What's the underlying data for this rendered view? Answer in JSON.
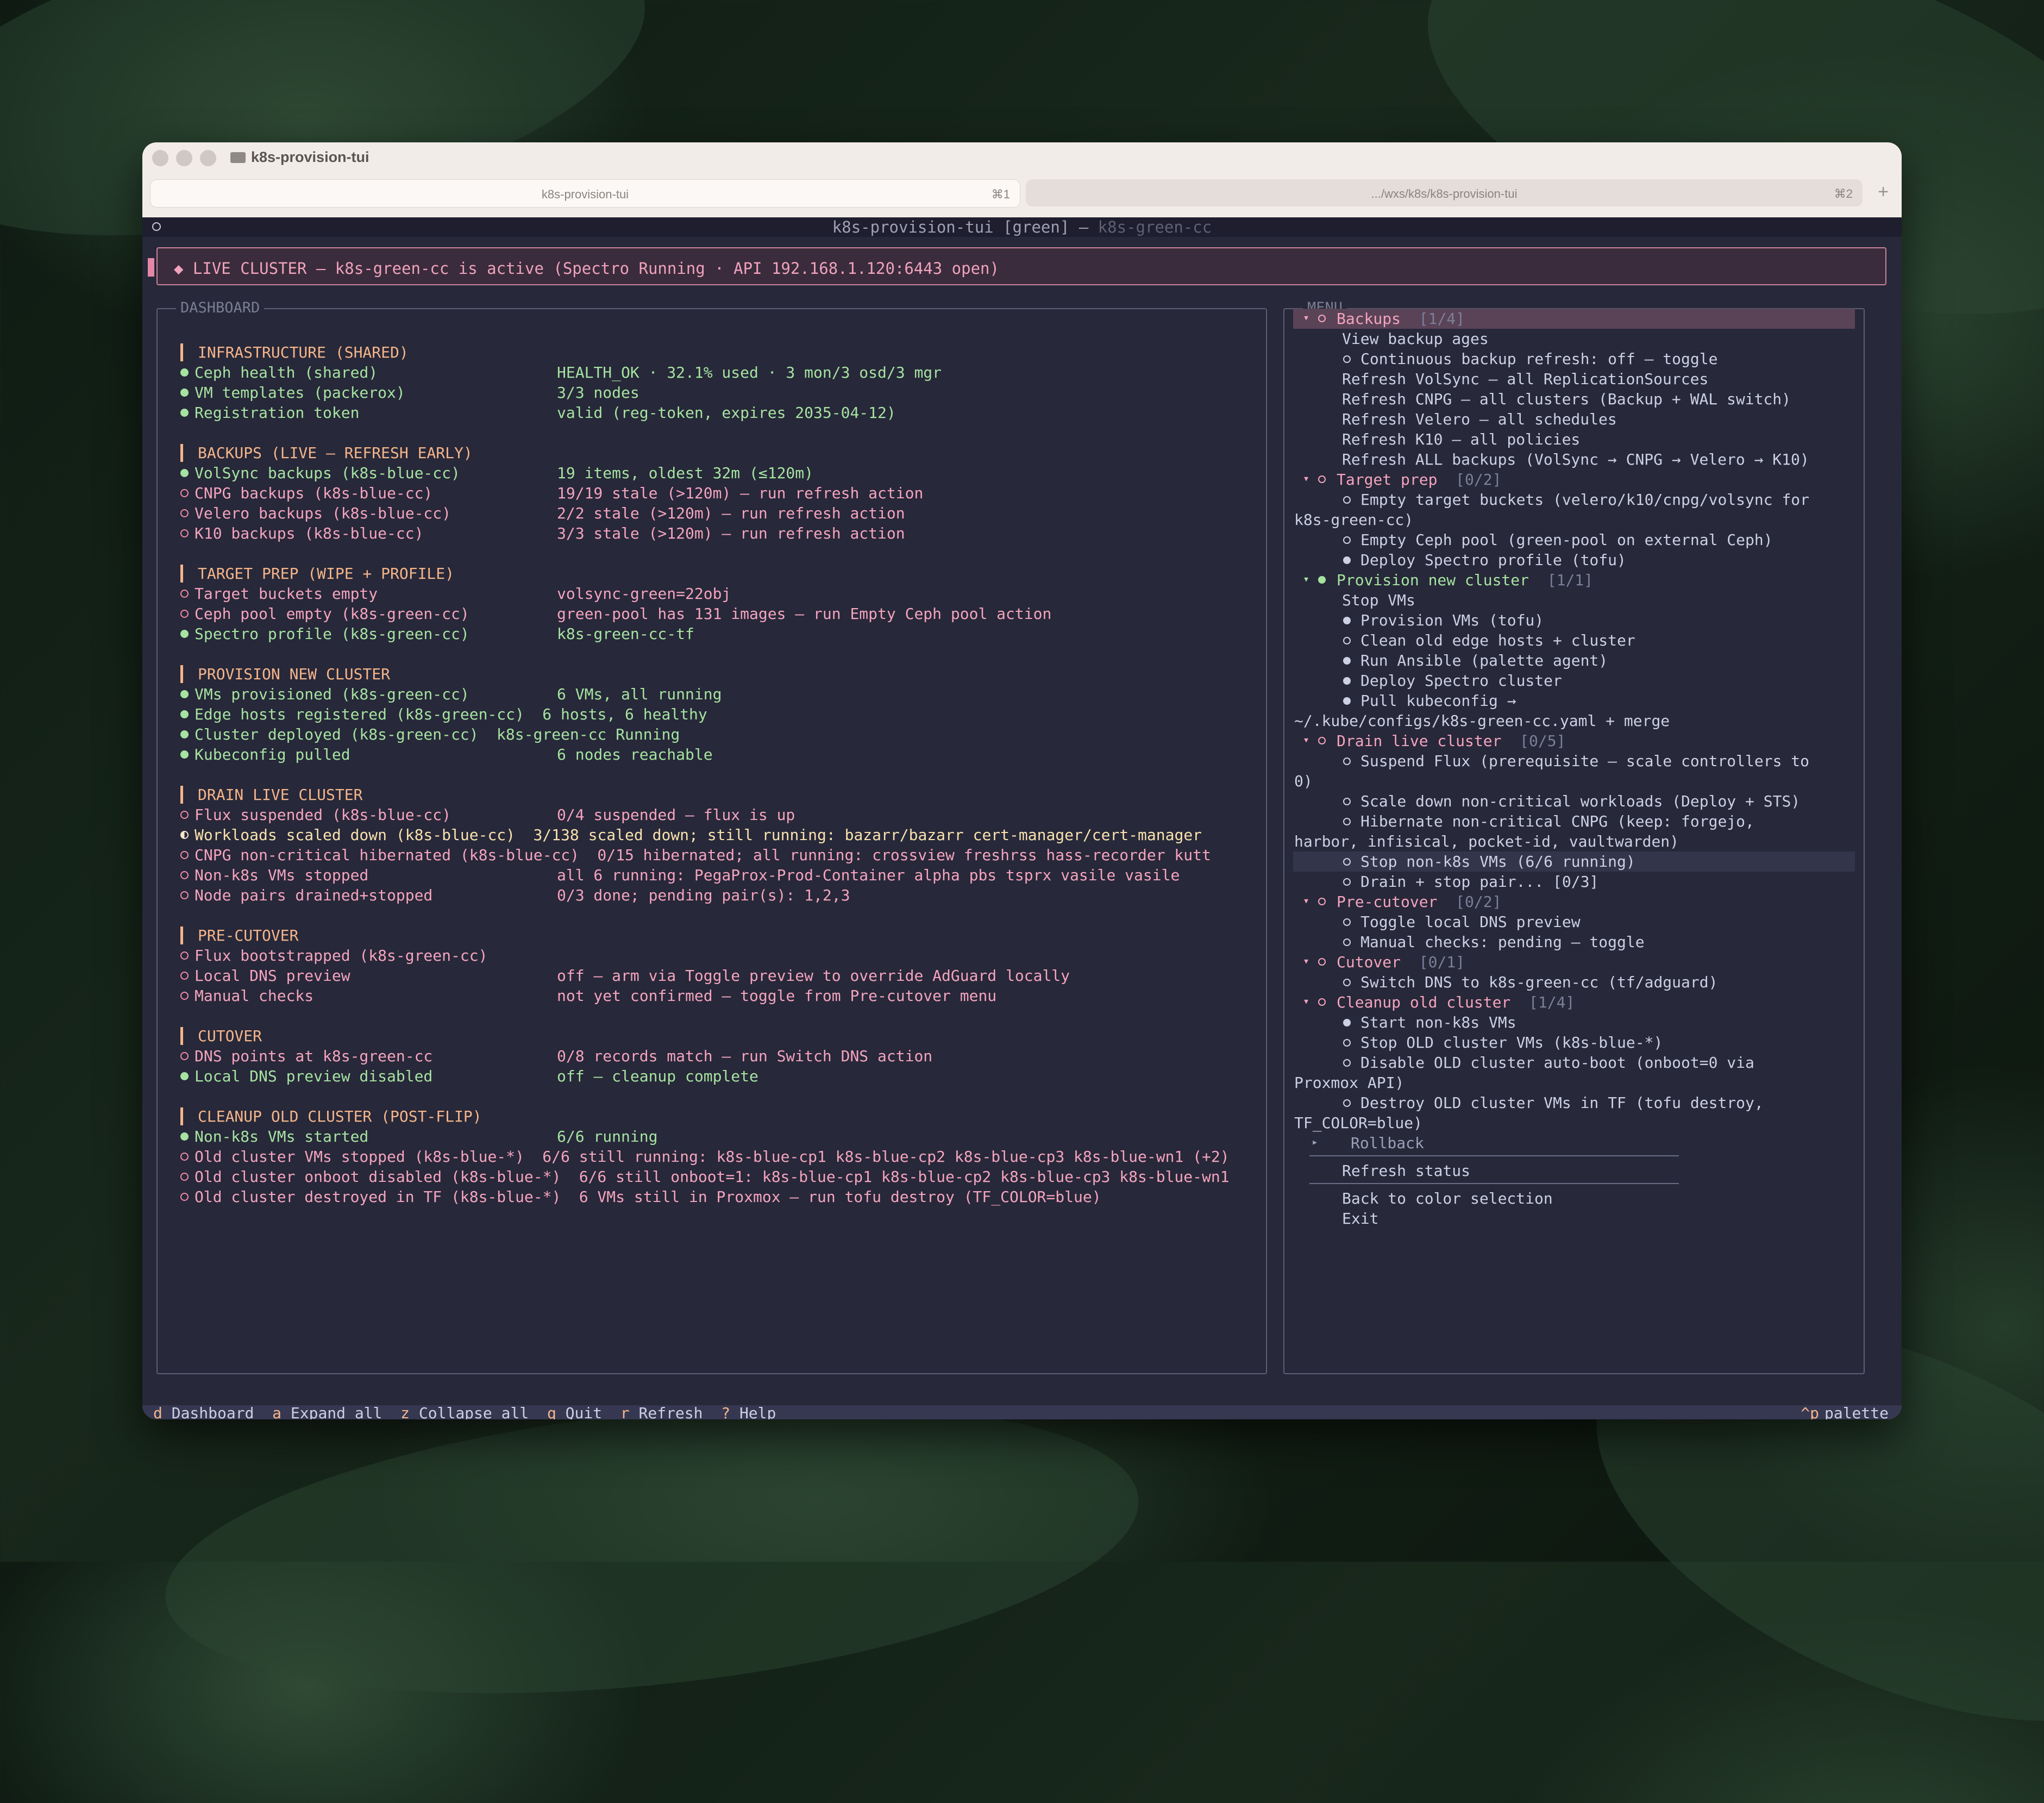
{
  "window": {
    "title": "k8s-provision-tui",
    "tabs": [
      {
        "label": "k8s-provision-tui",
        "shortcut": "⌘1"
      },
      {
        "label": ".../wxs/k8s/k8s-provision-tui",
        "shortcut": "⌘2"
      }
    ],
    "new_tab": "+"
  },
  "terminal": {
    "header_main": "k8s-provision-tui [green] — ",
    "header_dim": "k8s-green-cc"
  },
  "alert": {
    "text": "◆ LIVE CLUSTER — k8s-green-cc is active (Spectro Running · API 192.168.1.120:6443 open)"
  },
  "dashboard": {
    "title": "DASHBOARD",
    "sections": [
      {
        "title": "INFRASTRUCTURE (SHARED)",
        "rows": [
          {
            "state": "ok",
            "label": "Ceph health (shared)",
            "value": "HEALTH_OK · 32.1% used · 3 mon/3 osd/3 mgr"
          },
          {
            "state": "ok",
            "label": "VM templates (packerox)",
            "value": "3/3 nodes"
          },
          {
            "state": "ok",
            "label": "Registration token",
            "value": "valid (reg-token, expires 2035-04-12)"
          }
        ]
      },
      {
        "title": "BACKUPS (LIVE — REFRESH EARLY)",
        "rows": [
          {
            "state": "ok",
            "label": "VolSync backups (k8s-blue-cc)",
            "value": "19 items, oldest 32m (≤120m)"
          },
          {
            "state": "bad",
            "label": "CNPG backups (k8s-blue-cc)",
            "value": "19/19 stale (>120m) — run refresh action"
          },
          {
            "state": "bad",
            "label": "Velero backups (k8s-blue-cc)",
            "value": "2/2 stale (>120m) — run refresh action"
          },
          {
            "state": "bad",
            "label": "K10 backups (k8s-blue-cc)",
            "value": "3/3 stale (>120m) — run refresh action"
          }
        ]
      },
      {
        "title": "TARGET PREP (WIPE + PROFILE)",
        "rows": [
          {
            "state": "bad",
            "label": "Target buckets empty",
            "value": "volsync-green=22obj"
          },
          {
            "state": "bad",
            "label": "Ceph pool empty (k8s-green-cc)",
            "value": "green-pool has 131 images — run Empty Ceph pool action"
          },
          {
            "state": "ok",
            "label": "Spectro profile (k8s-green-cc)",
            "value": "k8s-green-cc-tf"
          }
        ]
      },
      {
        "title": "PROVISION NEW CLUSTER",
        "rows": [
          {
            "state": "ok",
            "label": "VMs provisioned (k8s-green-cc)",
            "value": "6 VMs, all running"
          },
          {
            "state": "ok",
            "label": "Edge hosts registered (k8s-green-cc)",
            "value": "6 hosts, 6 healthy"
          },
          {
            "state": "ok",
            "label": "Cluster deployed (k8s-green-cc)",
            "value": "k8s-green-cc Running"
          },
          {
            "state": "ok",
            "label": "Kubeconfig pulled",
            "value": "6 nodes reachable"
          }
        ]
      },
      {
        "title": "DRAIN LIVE CLUSTER",
        "rows": [
          {
            "state": "bad",
            "label": "Flux suspended (k8s-blue-cc)",
            "value": "0/4 suspended — flux is up"
          },
          {
            "state": "warn",
            "label": "Workloads scaled down (k8s-blue-cc)",
            "value": "3/138 scaled down; still running: bazarr/bazarr cert-manager/cert-manager"
          },
          {
            "state": "bad",
            "label": "CNPG non-critical hibernated (k8s-blue-cc)",
            "value": "0/15 hibernated; all running: crossview freshrss hass-recorder kutt"
          },
          {
            "state": "bad",
            "label": "Non-k8s VMs stopped",
            "value": "all 6 running: PegaProx-Prod-Container alpha pbs tsprx vasile vasile"
          },
          {
            "state": "bad",
            "label": "Node pairs drained+stopped",
            "value": "0/3 done; pending pair(s): 1,2,3"
          }
        ]
      },
      {
        "title": "PRE-CUTOVER",
        "rows": [
          {
            "state": "bad",
            "label": "Flux bootstrapped (k8s-green-cc)",
            "value": ""
          },
          {
            "state": "bad",
            "label": "Local DNS preview",
            "value": "off — arm via Toggle preview to override AdGuard locally"
          },
          {
            "state": "bad",
            "label": "Manual checks",
            "value": "not yet confirmed — toggle from Pre-cutover menu"
          }
        ]
      },
      {
        "title": "CUTOVER",
        "rows": [
          {
            "state": "bad",
            "label": "DNS points at k8s-green-cc",
            "value": "0/8 records match — run Switch DNS action"
          },
          {
            "state": "ok",
            "label": "Local DNS preview disabled",
            "value": "off — cleanup complete"
          }
        ]
      },
      {
        "title": "CLEANUP OLD CLUSTER (POST-FLIP)",
        "rows": [
          {
            "state": "ok",
            "label": "Non-k8s VMs started",
            "value": "6/6 running"
          },
          {
            "state": "bad",
            "label": "Old cluster VMs stopped (k8s-blue-*)",
            "value": "6/6 still running: k8s-blue-cp1 k8s-blue-cp2 k8s-blue-cp3 k8s-blue-wn1 (+2)"
          },
          {
            "state": "bad",
            "label": "Old cluster onboot disabled (k8s-blue-*)",
            "value": "6/6 still onboot=1: k8s-blue-cp1 k8s-blue-cp2 k8s-blue-cp3 k8s-blue-wn1"
          },
          {
            "state": "bad",
            "label": "Old cluster destroyed in TF (k8s-blue-*)",
            "value": "6 VMs still in Proxmox — run tofu destroy (TF_COLOR=blue)"
          }
        ]
      }
    ]
  },
  "menu": {
    "title": "MENU",
    "lines": [
      {
        "kind": "group",
        "name": "Backups",
        "count": "[1/4]",
        "status": "pink",
        "selected": true
      },
      {
        "kind": "plain",
        "text": "View backup ages"
      },
      {
        "kind": "open",
        "text": "Continuous backup refresh: off — toggle"
      },
      {
        "kind": "plain",
        "text": "Refresh VolSync — all ReplicationSources"
      },
      {
        "kind": "plain",
        "text": "Refresh CNPG — all clusters (Backup + WAL switch)"
      },
      {
        "kind": "plain",
        "text": "Refresh Velero — all schedules"
      },
      {
        "kind": "plain",
        "text": "Refresh K10 — all policies"
      },
      {
        "kind": "plain",
        "text": "Refresh ALL backups (VolSync → CNPG → Velero → K10)"
      },
      {
        "kind": "group",
        "name": "Target prep",
        "count": "[0/2]",
        "status": "pink"
      },
      {
        "kind": "open",
        "text": "Empty target buckets (velero/k10/cnpg/volsync for"
      },
      {
        "kind": "wrap",
        "text": "k8s-green-cc)"
      },
      {
        "kind": "open",
        "text": "Empty Ceph pool (green-pool on external Ceph)"
      },
      {
        "kind": "fill",
        "text": "Deploy Spectro profile (tofu)"
      },
      {
        "kind": "group",
        "name": "Provision new cluster",
        "count": "[1/1]",
        "status": "green"
      },
      {
        "kind": "plain",
        "text": "Stop VMs"
      },
      {
        "kind": "fill",
        "text": "Provision VMs (tofu)"
      },
      {
        "kind": "open",
        "text": "Clean old edge hosts + cluster"
      },
      {
        "kind": "fill",
        "text": "Run Ansible (palette agent)"
      },
      {
        "kind": "fill",
        "text": "Deploy Spectro cluster"
      },
      {
        "kind": "fill",
        "text": "Pull kubeconfig →"
      },
      {
        "kind": "wrap",
        "text": "~/.kube/configs/k8s-green-cc.yaml + merge"
      },
      {
        "kind": "group",
        "name": "Drain live cluster",
        "count": "[0/5]",
        "status": "pink"
      },
      {
        "kind": "open",
        "text": "Suspend Flux (prerequisite — scale controllers to"
      },
      {
        "kind": "wrap",
        "text": "0)"
      },
      {
        "kind": "open",
        "text": "Scale down non-critical workloads (Deploy + STS)"
      },
      {
        "kind": "open",
        "text": "Hibernate non-critical CNPG (keep: forgejo,"
      },
      {
        "kind": "wrap",
        "text": "harbor, infisical, pocket-id, vaultwarden)"
      },
      {
        "kind": "open",
        "text": "Stop non-k8s VMs (6/6 running)",
        "hover": true
      },
      {
        "kind": "open",
        "text": "Drain + stop pair... [0/3]"
      },
      {
        "kind": "group",
        "name": "Pre-cutover",
        "count": "[0/2]",
        "status": "pink"
      },
      {
        "kind": "open",
        "text": "Toggle local DNS preview"
      },
      {
        "kind": "open",
        "text": "Manual checks: pending — toggle"
      },
      {
        "kind": "group",
        "name": "Cutover",
        "count": "[0/1]",
        "status": "pink"
      },
      {
        "kind": "open",
        "text": "Switch DNS to k8s-green-cc (tf/adguard)"
      },
      {
        "kind": "group",
        "name": "Cleanup old cluster",
        "count": "[1/4]",
        "status": "pink"
      },
      {
        "kind": "fill",
        "text": "Start non-k8s VMs"
      },
      {
        "kind": "open",
        "text": "Stop OLD cluster VMs (k8s-blue-*)"
      },
      {
        "kind": "open",
        "text": "Disable OLD cluster auto-boot (onboot=0 via"
      },
      {
        "kind": "wrap",
        "text": "Proxmox API)"
      },
      {
        "kind": "open",
        "text": "Destroy OLD cluster VMs in TF (tofu destroy,"
      },
      {
        "kind": "wrap",
        "text": "TF_COLOR=blue)"
      },
      {
        "kind": "collapsed",
        "text": "Rollback"
      },
      {
        "kind": "sep"
      },
      {
        "kind": "plain",
        "text": "Refresh status"
      },
      {
        "kind": "sep"
      },
      {
        "kind": "plain",
        "text": "Back to color selection"
      },
      {
        "kind": "plain",
        "text": "Exit"
      }
    ]
  },
  "statusbar": {
    "shortcuts": [
      {
        "key": "d",
        "label": "Dashboard"
      },
      {
        "key": "a",
        "label": "Expand all"
      },
      {
        "key": "z",
        "label": "Collapse all"
      },
      {
        "key": "q",
        "label": "Quit"
      },
      {
        "key": "r",
        "label": "Refresh"
      },
      {
        "key": "?",
        "label": "Help"
      }
    ],
    "palette_key": "^p",
    "palette_label": "palette"
  },
  "colors": {
    "ok": "#a6e3a1",
    "bad": "#f4a4be",
    "section": "#f5b58a",
    "terminal_bg": "#272839"
  }
}
